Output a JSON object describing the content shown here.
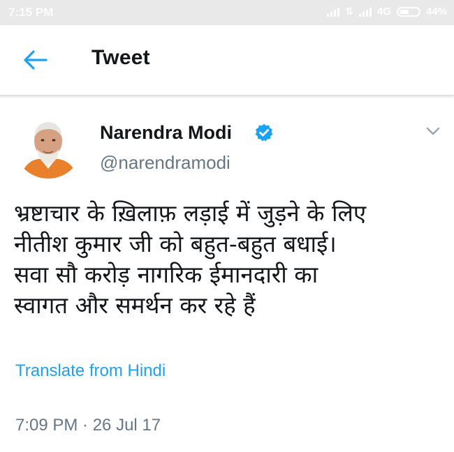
{
  "status_bar": {
    "time": "7:15 PM",
    "network": "4G",
    "battery": "44%"
  },
  "header": {
    "title": "Tweet",
    "back_icon": "arrow-left-icon"
  },
  "tweet": {
    "display_name": "Narendra Modi",
    "handle": "@narendramodi",
    "verified": true,
    "text_lines": [
      "भ्रष्टाचार के ख़िलाफ़ लड़ाई में जुड़ने के लिए",
      "नीतीश कुमार जी को बहुत-बहुत बधाई।",
      "सवा सौ करोड़ नागरिक ईमानदारी का",
      "स्वागत और समर्थन कर रहे हैं"
    ],
    "translate_label": "Translate from Hindi",
    "timestamp": "7:09 PM · 26 Jul 17"
  },
  "colors": {
    "accent": "#1da1f2",
    "text_primary": "#14171a",
    "text_secondary": "#657786",
    "status_bar_bg": "#e9e9e9"
  }
}
